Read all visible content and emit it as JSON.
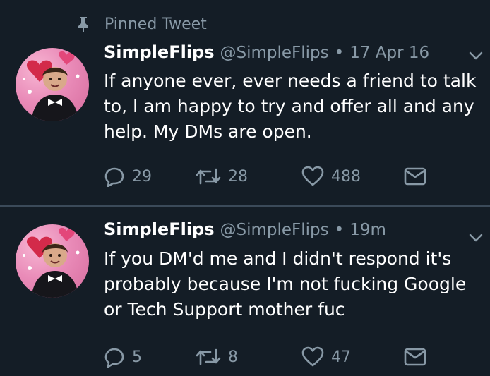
{
  "pinned_label": "Pinned Tweet",
  "tweets": [
    {
      "name": "SimpleFlips",
      "handle": "@SimpleFlips",
      "separator": "•",
      "time": "17 Apr 16",
      "text": "If anyone ever, ever needs a friend to talk to, I am happy to try and offer all and any help. My DMs are open.",
      "replies": "29",
      "retweets": "28",
      "likes": "488"
    },
    {
      "name": "SimpleFlips",
      "handle": "@SimpleFlips",
      "separator": "•",
      "time": "19m",
      "text": "If you DM'd me and I didn't respond it's probably because I'm not fucking Google or Tech Support mother fuc",
      "replies": "5",
      "retweets": "8",
      "likes": "47"
    }
  ],
  "colors": {
    "background": "#141d26",
    "muted": "#8899a6",
    "text": "#ffffff",
    "divider": "#3b4a59"
  },
  "icons": [
    "pin-icon",
    "chevron-down-icon",
    "reply-icon",
    "retweet-icon",
    "heart-icon",
    "envelope-icon"
  ]
}
